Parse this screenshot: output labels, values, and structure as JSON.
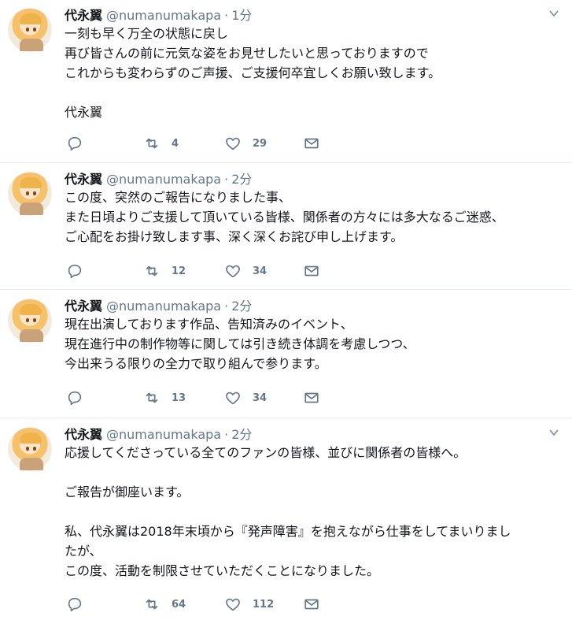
{
  "tweets": [
    {
      "name": "代永翼",
      "handle": "@numanumakapa",
      "time": "1分",
      "lines": [
        "一刻も早く万全の状態に戻し",
        "再び皆さんの前に元気な姿をお見せしたいと思っておりますので",
        "これからも変わらずのご声援、ご支援何卒宜しくお願い致します。",
        "",
        "代永翼"
      ],
      "retweets": "4",
      "likes": "29"
    },
    {
      "name": "代永翼",
      "handle": "@numanumakapa",
      "time": "2分",
      "lines": [
        "この度、突然のご報告になりました事、",
        "また日頃よりご支援して頂いている皆様、関係者の方々には多大なるご迷惑、",
        "ご心配をお掛け致します事、深く深くお詫び申し上げます。"
      ],
      "retweets": "12",
      "likes": "34"
    },
    {
      "name": "代永翼",
      "handle": "@numanumakapa",
      "time": "2分",
      "lines": [
        "現在出演しております作品、告知済みのイベント、",
        "現在進行中の制作物等に関しては引き続き体調を考慮しつつ、",
        "今出来うる限りの全力で取り組んで参ります。"
      ],
      "retweets": "13",
      "likes": "34"
    },
    {
      "name": "代永翼",
      "handle": "@numanumakapa",
      "time": "2分",
      "lines": [
        "応援してくださっている全てのファンの皆様、並びに関係者の皆様へ。",
        "",
        "ご報告が御座います。",
        "",
        "私、代永翼は2018年末頃から『発声障害』を抱えながら仕事をしてまいりまし",
        "たが、",
        "この度、活動を制限させていただくことになりました。"
      ],
      "retweets": "64",
      "likes": "112"
    }
  ],
  "icons": {
    "reply": "reply-icon",
    "retweet": "retweet-icon",
    "like": "heart-icon",
    "dm": "envelope-icon",
    "menu": "chevron-down-icon"
  },
  "colors": {
    "text": "#14171a",
    "muted": "#657786",
    "divider": "#e6ecf0"
  }
}
